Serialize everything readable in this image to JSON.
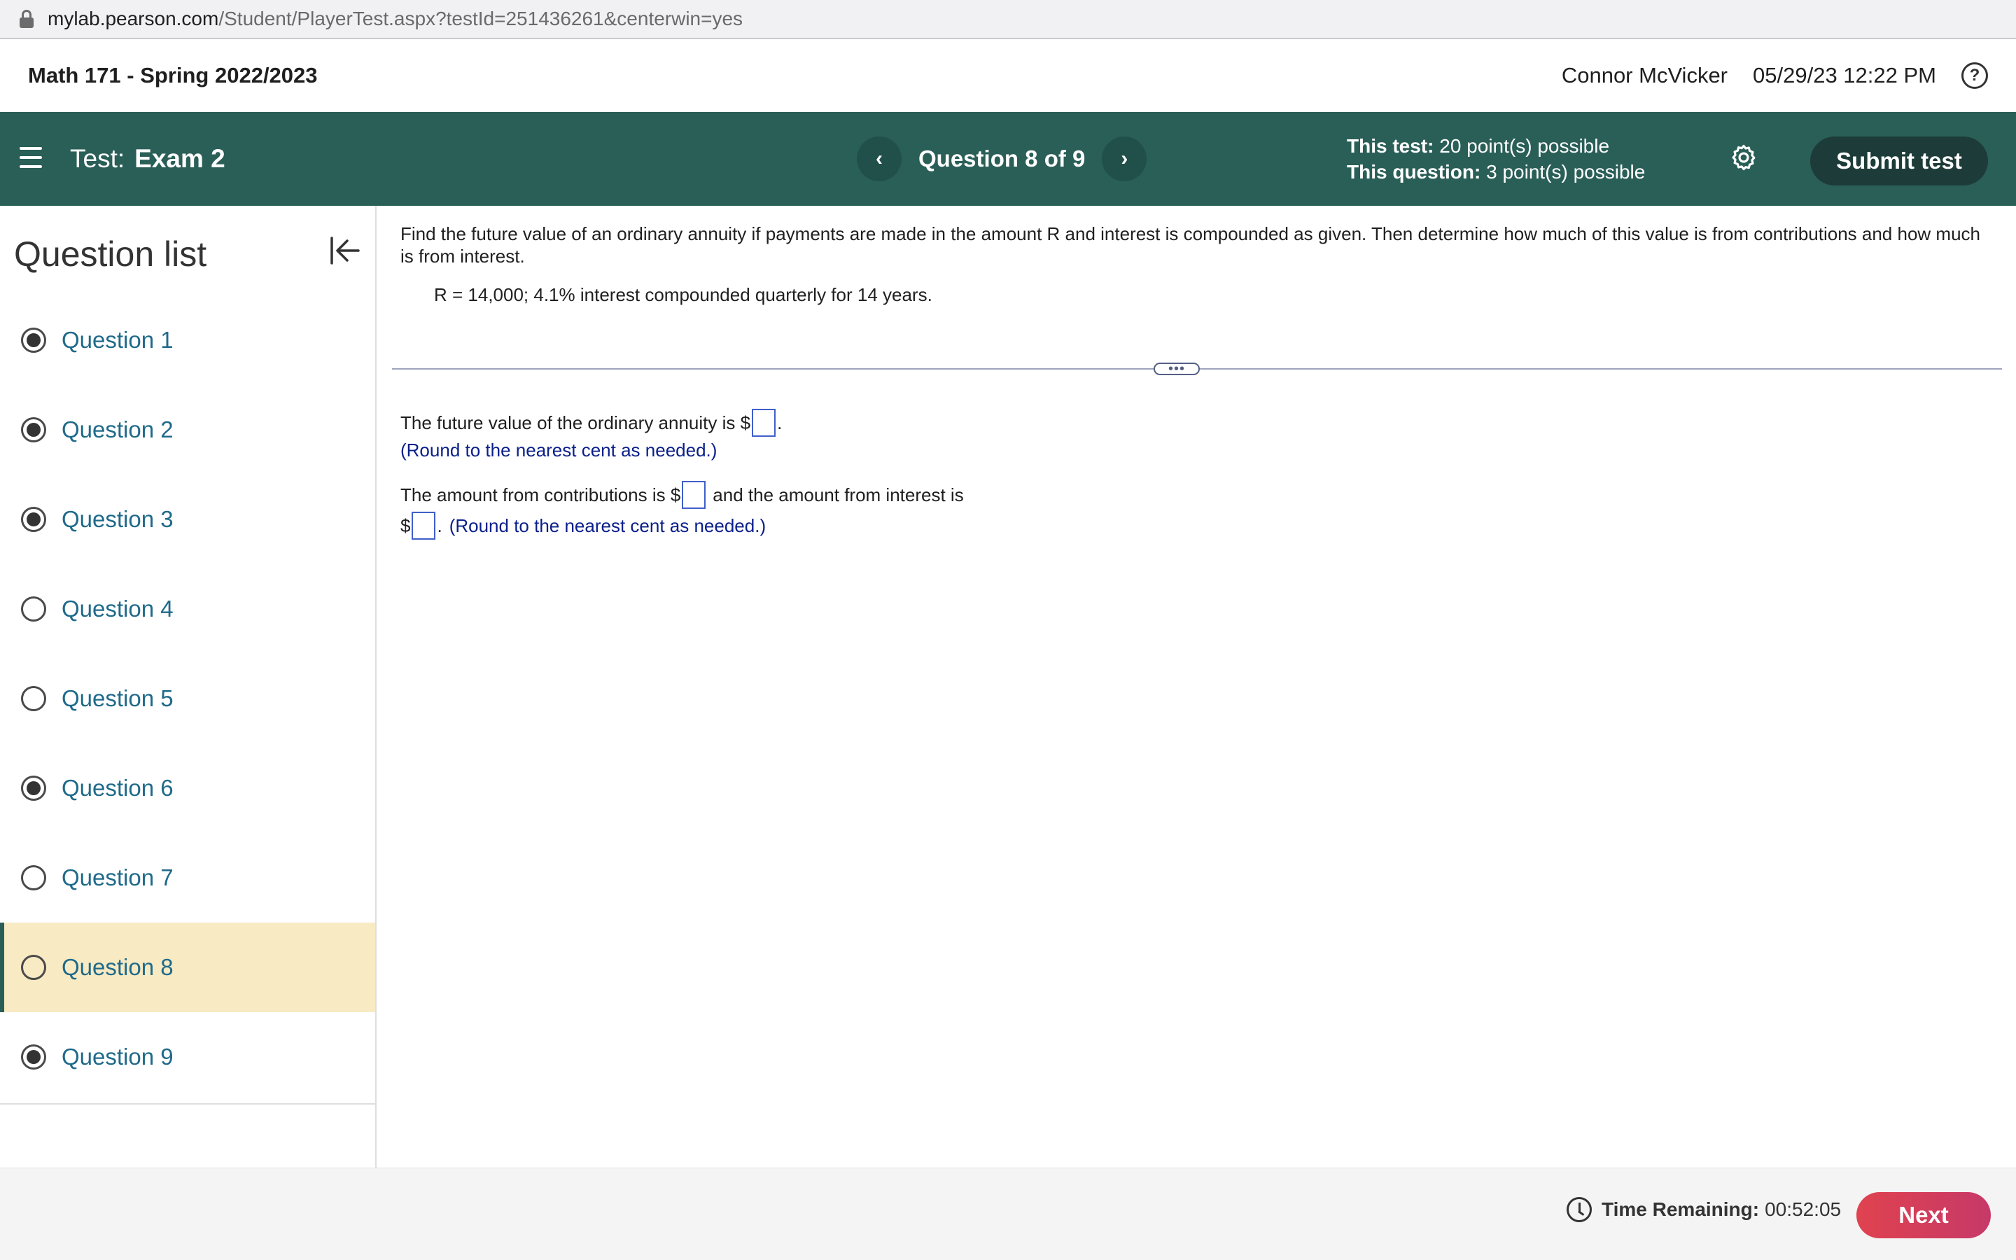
{
  "browser": {
    "url_domain": "mylab.pearson.com",
    "url_path": "/Student/PlayerTest.aspx?testId=251436261&centerwin=yes"
  },
  "course": {
    "title": "Math 171 - Spring 2022/2023",
    "user": "Connor McVicker",
    "datetime": "05/29/23 12:22 PM",
    "help_glyph": "?"
  },
  "testbar": {
    "label": "Test:",
    "name": "Exam 2",
    "prev_glyph": "‹",
    "next_glyph": "›",
    "question_position": "Question 8 of 9",
    "test_points_label": "This test:",
    "test_points_value": "20 point(s) possible",
    "question_points_label": "This question:",
    "question_points_value": "3 point(s) possible",
    "settings_icon": "gear-icon",
    "submit_label": "Submit test"
  },
  "sidebar": {
    "heading": "Question list",
    "collapse_icon": "collapse-left-icon",
    "items": [
      {
        "label": "Question 1",
        "answered": true,
        "current": false
      },
      {
        "label": "Question 2",
        "answered": true,
        "current": false
      },
      {
        "label": "Question 3",
        "answered": true,
        "current": false
      },
      {
        "label": "Question 4",
        "answered": false,
        "current": false
      },
      {
        "label": "Question 5",
        "answered": false,
        "current": false
      },
      {
        "label": "Question 6",
        "answered": true,
        "current": false
      },
      {
        "label": "Question 7",
        "answered": false,
        "current": false
      },
      {
        "label": "Question 8",
        "answered": false,
        "current": true
      },
      {
        "label": "Question 9",
        "answered": true,
        "current": false
      }
    ]
  },
  "question": {
    "prompt": "Find the future value of an ordinary annuity if payments are made in the amount R and interest is compounded as given. Then determine how much of this value is from contributions and how much is from interest.",
    "given": "R = 14,000; 4.1% interest compounded quarterly for 14 years.",
    "divider_handle": "•••",
    "answer1_text": "The future value of the ordinary annuity is $",
    "answer1_end": ".",
    "answer1_hint": "(Round to the nearest cent as needed.)",
    "answer2_text_a": "The amount from contributions is $",
    "answer2_text_b": "and the amount from interest is",
    "answer2_dollar": "$",
    "answer2_end": ".",
    "answer2_hint": "(Round to the nearest cent as needed.)"
  },
  "footer": {
    "clock_icon": "clock-icon",
    "time_label": "Time Remaining:",
    "time_value": "00:52:05",
    "next_label": "Next"
  },
  "colors": {
    "header_green": "#2a5f58",
    "submit_dark": "#1d3c39",
    "current_highlight": "#f8eac3",
    "link_blue": "#1f6a8a",
    "hint_blue": "#0a1f8a",
    "next_red": "#d93e5a"
  }
}
